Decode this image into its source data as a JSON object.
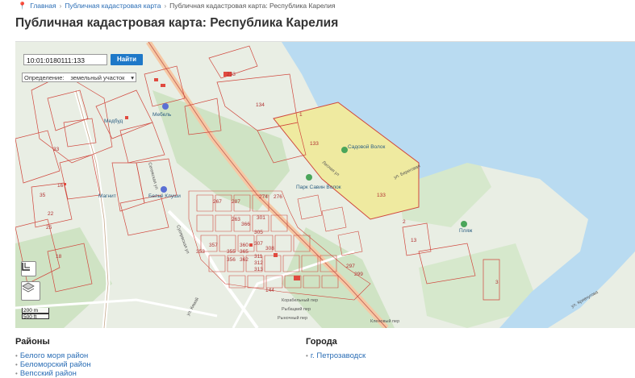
{
  "breadcrumb": {
    "items": [
      "Главная",
      "Публичная кадастровая карта",
      "Публичная кадастровая карта: Республика Карелия"
    ]
  },
  "page": {
    "title": "Публичная кадастровая карта: Республика Карелия"
  },
  "map": {
    "search_value": "10:01:0180111:133",
    "search_button": "Найти",
    "definition_label": "Определение:",
    "definition_value": "земельный участок",
    "scale_200": "200 m",
    "scale_500": "500 ft",
    "parcel_labels": [
      "233",
      "134",
      "1",
      "133",
      "133",
      "33",
      "16",
      "13",
      "35",
      "22",
      "25",
      "18",
      "274",
      "276",
      "307",
      "308",
      "366",
      "301",
      "305",
      "311",
      "312",
      "313",
      "360",
      "357",
      "355",
      "353",
      "356",
      "365",
      "362",
      "267",
      "287",
      "297",
      "299",
      "3",
      "2",
      "144",
      "263"
    ],
    "place_labels": [
      "Садовой Волок",
      "Парк Савин Волок",
      "Пляж",
      "Медбуд",
      "Мебель",
      "Магнит",
      "Бельё Клуши",
      "Суоярвская ул",
      "Сегежская ул",
      "Корабельный пер",
      "ул. Кривчугова",
      "ул. Береговая",
      "Лесная ул",
      "ул. Кямяй",
      "Рыбацкий пер",
      "Рыночный пер",
      "Кленовый пер"
    ]
  },
  "districts": {
    "heading": "Районы",
    "items": [
      "Белого моря район",
      "Беломорский район",
      "Вепсский район"
    ]
  },
  "cities": {
    "heading": "Города",
    "items": [
      "г. Петрозаводск"
    ]
  }
}
